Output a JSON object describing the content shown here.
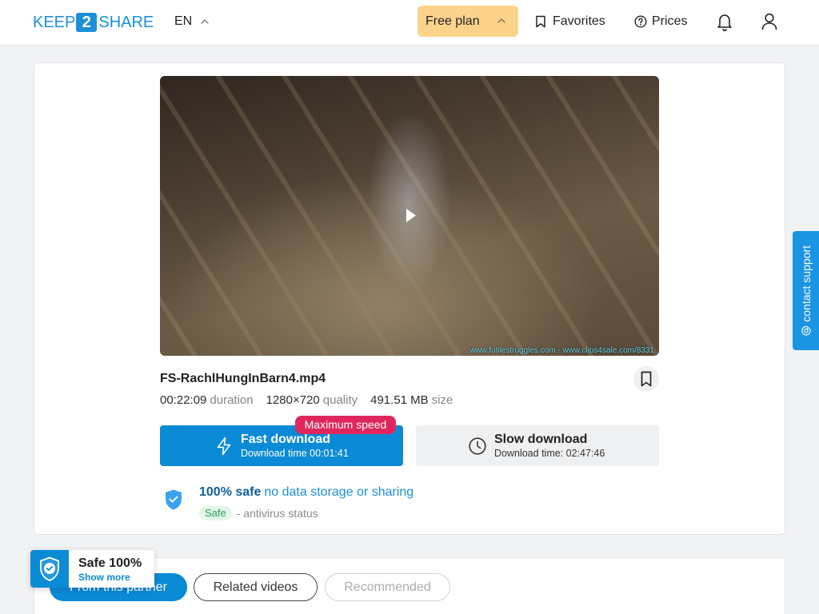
{
  "header": {
    "logo": {
      "left": "KEEP",
      "middle": "2",
      "right": "SHARE"
    },
    "language": {
      "label": "EN",
      "icon": "chevron-up-icon"
    },
    "plan": {
      "label": "Free plan",
      "icon": "chevron-up-icon"
    },
    "favorites": {
      "label": "Favorites",
      "icon": "bookmark-icon"
    },
    "prices": {
      "label": "Prices",
      "icon": "question-circle-icon"
    },
    "notifications": {
      "icon": "bell-icon"
    },
    "account": {
      "icon": "user-icon"
    }
  },
  "file": {
    "preview": {
      "watermark": "www.futilestruggles.com - www.clips4sale.com/8331",
      "icon": "play-icon"
    },
    "name": "FS-RachlHungInBarn4.mp4",
    "bookmark_icon": "bookmark-icon",
    "meta": [
      {
        "value": "00:22:09",
        "label": "duration"
      },
      {
        "value": "1280×720",
        "label": "quality"
      },
      {
        "value": "491.51 MB",
        "label": "size"
      }
    ]
  },
  "downloads": {
    "fast": {
      "title": "Fast download",
      "time": "Download time 00:01:41",
      "badge": "Maximum speed",
      "icon": "lightning-icon"
    },
    "slow": {
      "title": "Slow download",
      "time": "Download time: 02:47:46",
      "icon": "clock-icon"
    }
  },
  "safety": {
    "icon": "shield-check-icon",
    "headline": "100% safe",
    "description": "no data storage or sharing",
    "badge": "Safe",
    "status": "- antivirus status"
  },
  "tabs": [
    {
      "label": "From this partner",
      "active": true,
      "disabled": false
    },
    {
      "label": "Related videos",
      "active": false,
      "disabled": false
    },
    {
      "label": "Recommended",
      "active": false,
      "disabled": true
    }
  ],
  "safe_widget": {
    "title": "Safe 100%",
    "link": "Show more",
    "icon": "shield-check-icon"
  },
  "support": {
    "label": "contact support",
    "icon": "at-sign-icon"
  },
  "colors": {
    "accent": "#0b8ad6",
    "plan_badge": "#fdd38c",
    "speed_badge": "#e0275d",
    "safe_green": "#2e9d55",
    "safe_green_bg": "#e3f6e9",
    "safety_headline": "#0e5f98",
    "safety_text": "#1b8fd6",
    "support_tab": "#1b94e4",
    "page_background": "#f1f2f4"
  }
}
